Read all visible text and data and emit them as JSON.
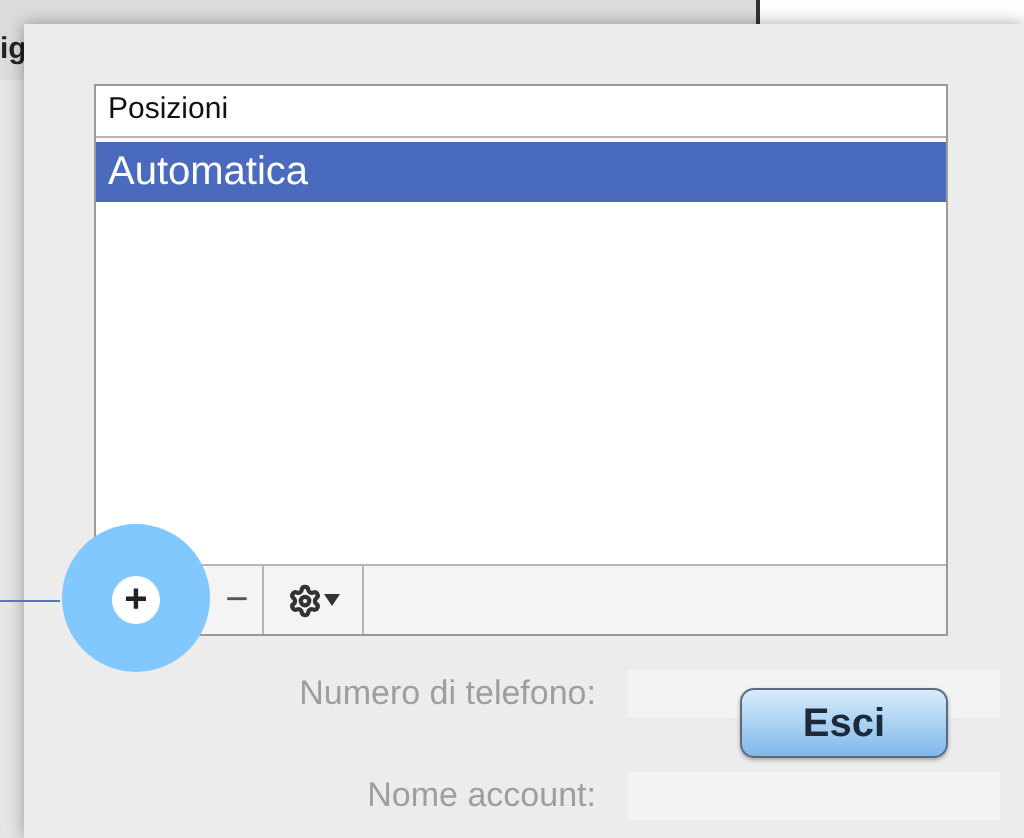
{
  "background": {
    "heading": "ig",
    "labels": [
      "Numero di telefono:",
      "Nome account:"
    ]
  },
  "list": {
    "header": "Posizioni",
    "rows": [
      {
        "label": "Automatica",
        "selected": true
      }
    ]
  },
  "toolbar": {
    "add": "+",
    "remove": "−"
  },
  "button": "Esci"
}
